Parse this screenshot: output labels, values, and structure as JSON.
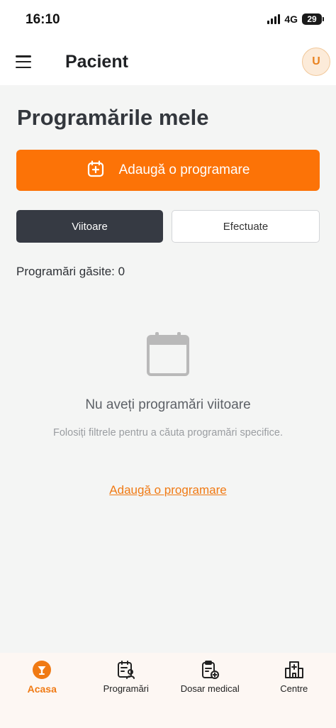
{
  "status_bar": {
    "time": "16:10",
    "network": "4G",
    "battery": "29"
  },
  "header": {
    "title": "Pacient",
    "avatar_initial": "U"
  },
  "page": {
    "title": "Programările mele",
    "add_button_label": "Adaugă o programare",
    "tabs": [
      {
        "label": "Viitoare",
        "active": true
      },
      {
        "label": "Efectuate",
        "active": false
      }
    ],
    "count_label": "Programări găsite: 0"
  },
  "empty_state": {
    "icon": "calendar-icon",
    "title": "Nu aveți programări viitoare",
    "subtitle": "Folosiți filtrele pentru a căuta programări specifice.",
    "link_label": "Adaugă o programare"
  },
  "bottom_nav": {
    "items": [
      {
        "label": "Acasa",
        "icon": "home-icon",
        "active": true
      },
      {
        "label": "Programări",
        "icon": "appointments-icon",
        "active": false
      },
      {
        "label": "Dosar medical",
        "icon": "medical-record-icon",
        "active": false
      },
      {
        "label": "Centre",
        "icon": "hospital-icon",
        "active": false
      }
    ]
  },
  "colors": {
    "accent": "#fc7307",
    "dark_tab": "#363a43",
    "background": "#f4f5f4"
  }
}
